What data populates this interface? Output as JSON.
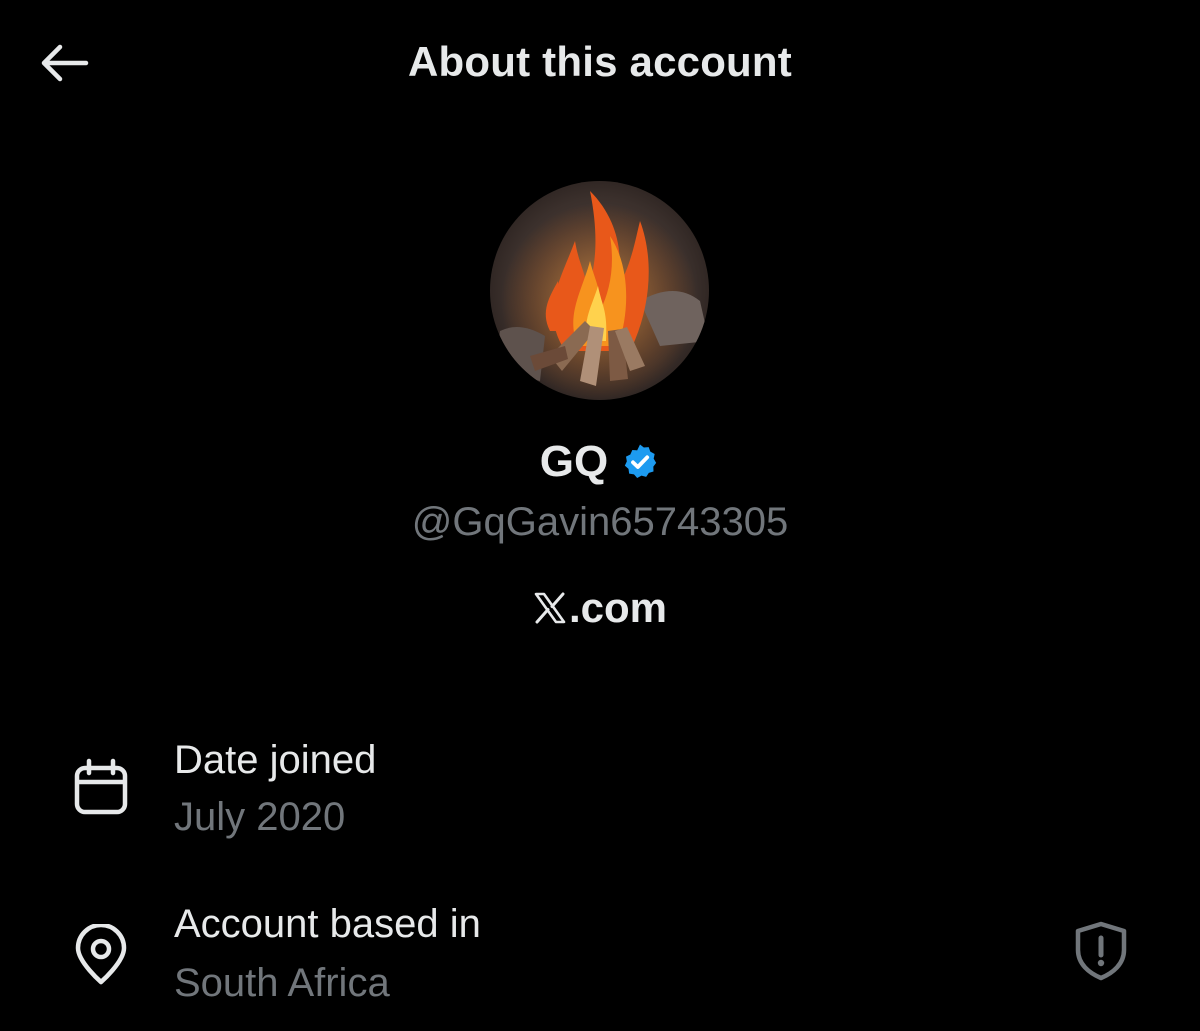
{
  "header": {
    "title": "About this account",
    "back_icon": "arrow-left-icon"
  },
  "profile": {
    "display_name": "GQ",
    "handle": "@GqGavin65743305",
    "verified": true,
    "verified_color": "#1d9bf0",
    "avatar_description_icon": "campfire-avatar",
    "site": {
      "logo_text": "𝕏",
      "label": ".com"
    }
  },
  "details": [
    {
      "icon": "calendar-icon",
      "label": "Date joined",
      "value": "July 2020"
    },
    {
      "icon": "location-pin-icon",
      "label": "Account based in",
      "value": "South Africa",
      "action_icon": "shield-alert-icon"
    }
  ],
  "colors": {
    "background": "#000000",
    "primary_text": "#e7e9ea",
    "secondary_text": "#71767b",
    "accent": "#1d9bf0"
  }
}
